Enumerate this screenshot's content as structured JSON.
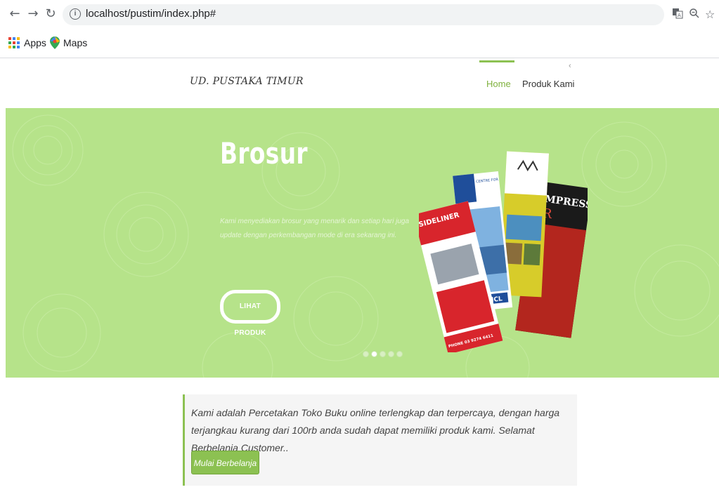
{
  "browser": {
    "url": "localhost/pustim/index.php#",
    "bookmarks": [
      {
        "label": "Apps",
        "icon": "apps-grid-icon"
      },
      {
        "label": "Maps",
        "icon": "maps-pin-icon"
      }
    ],
    "icons": [
      "back-arrow-icon",
      "forward-arrow-icon",
      "reload-icon",
      "info-icon",
      "translate-icon",
      "zoom-icon",
      "bookmark-star-icon"
    ]
  },
  "header": {
    "brand": "UD. PUSTAKA TIMUR",
    "nav": [
      {
        "label": "Home",
        "active": true
      },
      {
        "label": "Produk Kami",
        "active": false
      }
    ],
    "accent_color": "#8cc152"
  },
  "hero": {
    "title": "Brosur",
    "description": "Kami menyediakan brosur yang menarik dan setiap hari juga update dengan perkembangan mode di era sekarang ini.",
    "button_label": "LIHAT PRODUK",
    "background_color": "#b6e38a",
    "slides_count": 5,
    "active_slide": 2,
    "brochure_texts": [
      "SIDELINER",
      "PHONE 03 9274 6411",
      "CENTRE FOR MEDIA AND COMMUNICATIONS LAW",
      "CMCL",
      "EMPRESS"
    ]
  },
  "promo": {
    "text": "Kami adalah Percetakan Toko Buku online terlengkap dan terpercaya, dengan harga terjangkau kurang dari 100rb anda sudah dapat memiliki produk kami. Selamat Berbelanja Customer..",
    "button_label": "Mulai Berbelanja »"
  }
}
